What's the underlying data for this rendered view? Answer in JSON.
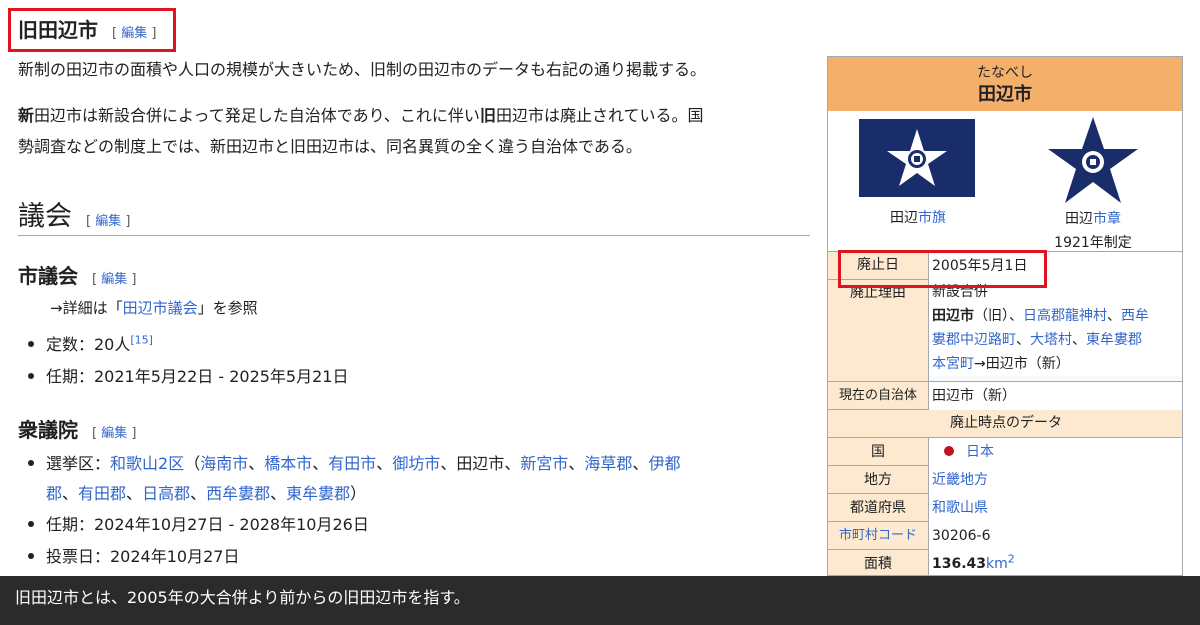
{
  "section1": {
    "title": "旧田辺市",
    "edit": "編集",
    "para1": "新制の田辺市の面積や人口の規模が大きいため、旧制の田辺市のデータも右記の通り掲載する。",
    "para2_b1": "新",
    "para2_t1": "田辺市は新設合併によって発足した自治体であり、これに伴い",
    "para2_b2": "旧",
    "para2_t2": "田辺市は廃止されている。国",
    "para2_line2": "勢調査などの制度上では、新田辺市と旧田辺市は、同名異質の全く違う自治体である。"
  },
  "section2": {
    "title": "議会",
    "edit": "編集",
    "sub1": {
      "title": "市議会",
      "edit": "編集",
      "detail_prefix": "→詳細は「",
      "detail_link": "田辺市議会",
      "detail_suffix": "」を参照",
      "items": [
        {
          "label": "定数：20人",
          "ref": "[15]"
        },
        {
          "label": "任期：2021年5月22日 - 2025年5月21日"
        }
      ]
    },
    "sub2": {
      "title": "衆議院",
      "edit": "編集",
      "district_label": "選挙区：",
      "district_link": "和歌山2区",
      "areas_open": "（",
      "areas_line1": [
        "海南市",
        "橋本市",
        "有田市",
        "御坊市",
        "田辺市",
        "新宮市",
        "海草郡",
        "伊都"
      ],
      "areas_line2": [
        "郡",
        "有田郡",
        "日高郡",
        "西牟婁郡",
        "東牟婁郡"
      ],
      "areas_close": "）",
      "term": "任期：2024年10月27日 - 2028年10月26日",
      "vote": "投票日：2024年10月27日"
    }
  },
  "infobox": {
    "kana": "たなべし",
    "name": "田辺市",
    "flag_caption_plain": "田辺",
    "flag_caption_link": "市旗",
    "emblem_caption_plain": "田辺",
    "emblem_caption_link": "市章",
    "emblem_year": "1921年制定",
    "abolish_date_label": "廃止日",
    "abolish_date": "2005年5月1日",
    "abolish_reason_label": "廃止理由",
    "abolish_reason_type": "新設合併",
    "abolish_reason_b": "田辺市",
    "abolish_reason_old": "（旧）、",
    "merged_line1": [
      "日高郡龍神村",
      "西牟"
    ],
    "merged_line2": [
      "婁郡中辺路町",
      "大塔村",
      "東牟婁郡"
    ],
    "merged_line3_link": "本宮町",
    "merged_line3_rest": "→田辺市（新）",
    "current_label": "現在の自治体",
    "current_value": "田辺市（新）",
    "band_label": "廃止時点のデータ",
    "country_label": "国",
    "country_value": "日本",
    "region_label": "地方",
    "region_value": "近畿地方",
    "pref_label": "都道府県",
    "pref_value": "和歌山県",
    "code_label": "市町村コード",
    "code_value": "30206-6",
    "area_label": "面積",
    "area_value": "136.43",
    "area_unit": "km",
    "area_sup": "2",
    "colors": {
      "header": "#f4b06b",
      "label_bg": "#fde9cf",
      "flag": "#1a2d6b",
      "highlight": "#e0141e"
    }
  },
  "caption": "旧田辺市とは、2005年の大合併より前からの旧田辺市を指す。"
}
